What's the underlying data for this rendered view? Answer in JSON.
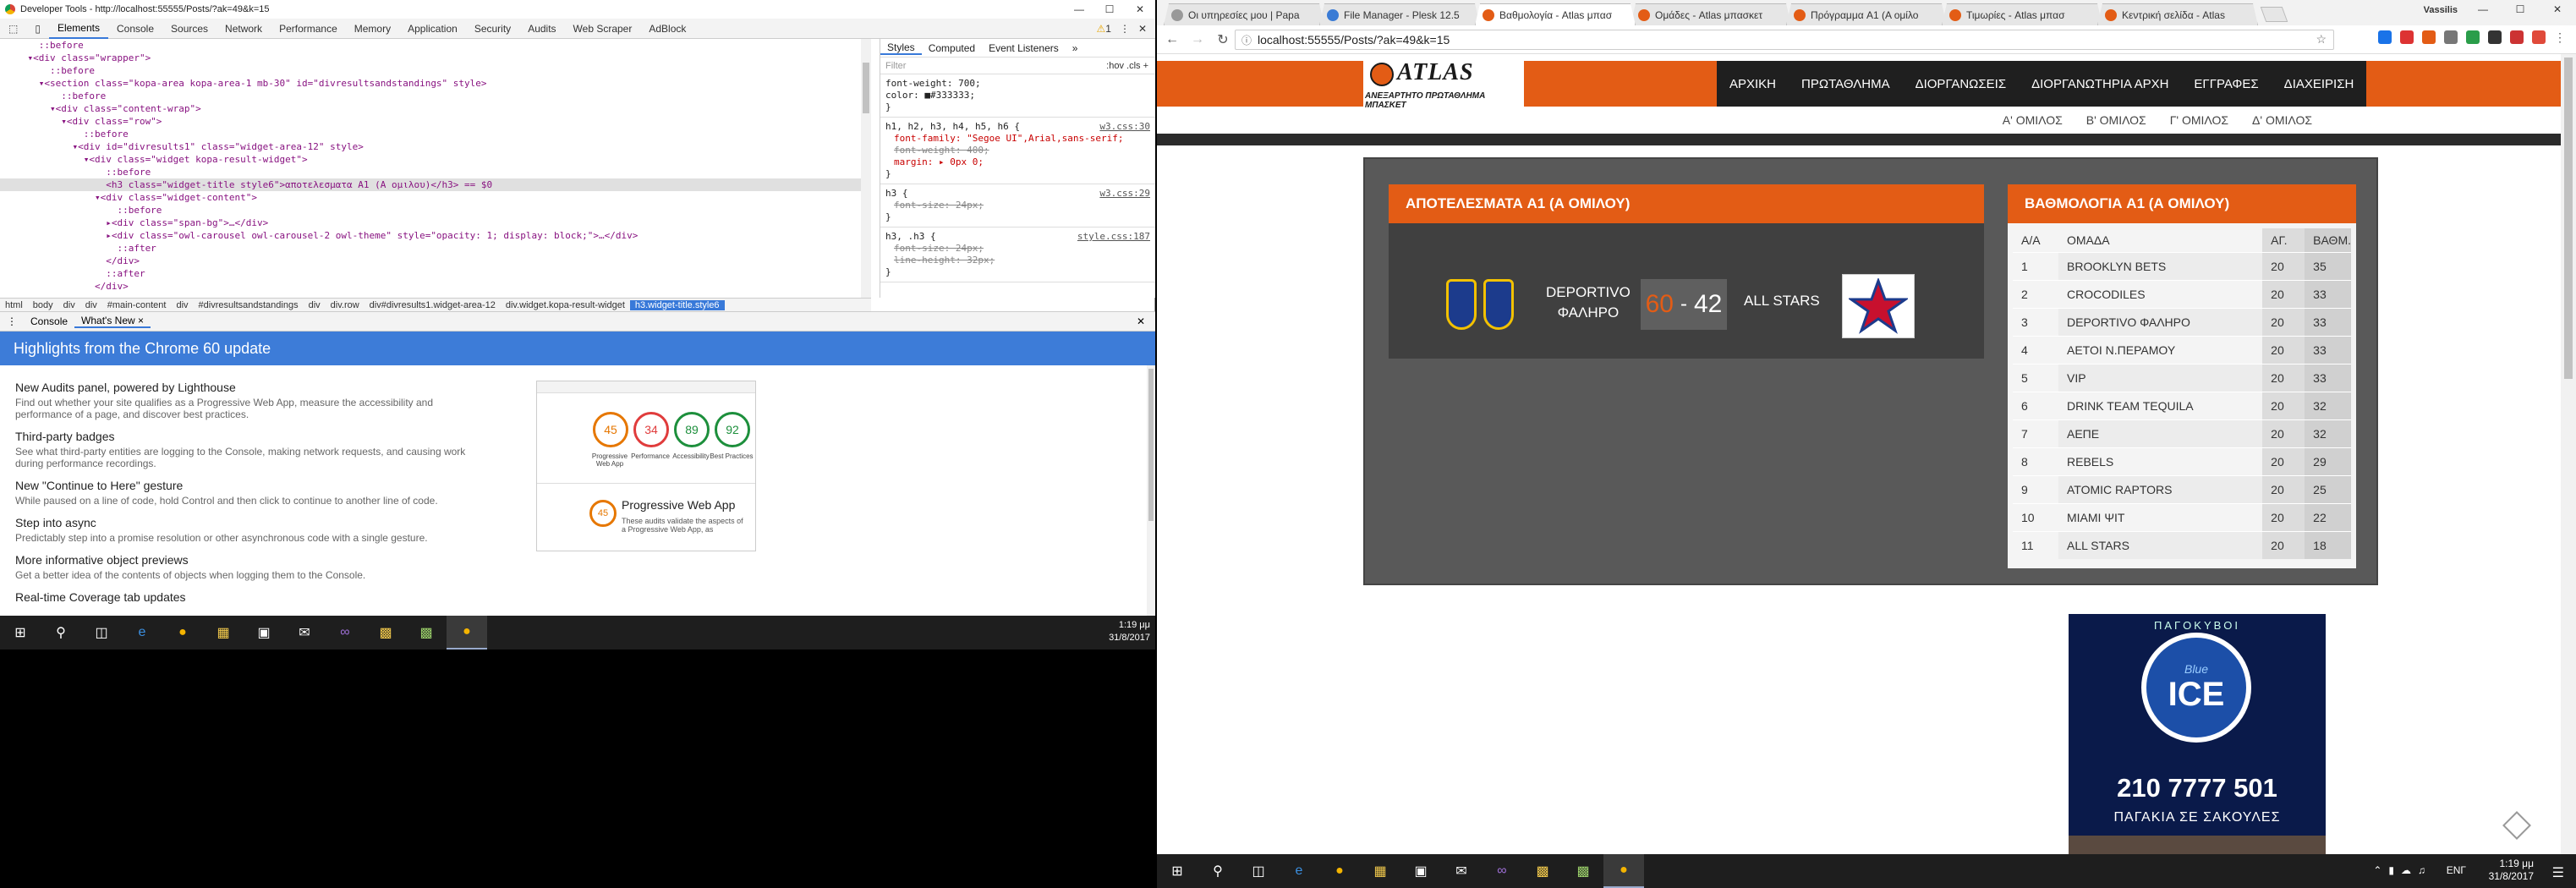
{
  "devtools": {
    "title": "Developer Tools - http://localhost:55555/Posts/?ak=49&k=15",
    "tabs": [
      "Elements",
      "Console",
      "Sources",
      "Network",
      "Performance",
      "Memory",
      "Application",
      "Security",
      "Audits",
      "Web Scraper",
      "AdBlock"
    ],
    "warning_count": "1",
    "dom_lines": [
      "      ::before",
      "    ▾<div class=\"wrapper\">",
      "        ::before",
      "      ▾<section class=\"kopa-area kopa-area-1 mb-30\" id=\"divresultsandstandings\" style>",
      "          ::before",
      "        ▾<div class=\"content-wrap\">",
      "          ▾<div class=\"row\">",
      "              ::before",
      "            ▾<div id=\"divresults1\" class=\"widget-area-12\" style>",
      "              ▾<div class=\"widget kopa-result-widget\">",
      "                  ::before",
      "                  <h3 class=\"widget-title style6\">αποτελεσματα A1 (Α ομιλου)</h3> == $0",
      "                ▾<div class=\"widget-content\">",
      "                    ::before",
      "                  ▸<div class=\"span-bg\">…</div>",
      "                  ▸<div class=\"owl-carousel owl-carousel-2 owl-theme\" style=\"opacity: 1; display: block;\">…</div>",
      "                    ::after",
      "                  </div>",
      "                  ::after",
      "                </div>"
    ],
    "styles_tabs": [
      "Styles",
      "Computed",
      "Event Listeners"
    ],
    "filter_placeholder": "Filter",
    "filter_tools": ":hov  .cls  +",
    "rules": [
      {
        "selector": "font-weight: 700;\ncolor: ■#333333;\n}",
        "source": ""
      },
      {
        "selector": "h1, h2, h3, h4, h5, h6 {",
        "source": "w3.css:30",
        "props": [
          "font-family: \"Segoe UI\",Arial,sans-serif;",
          "font-weight: 400;",
          "margin: ▸ 0px 0;",
          "}"
        ]
      },
      {
        "selector": "h3 {",
        "source": "w3.css:29",
        "props": [
          "font-size: 24px;",
          "}"
        ]
      },
      {
        "selector": "h3, .h3 {",
        "source": "style.css:187",
        "props": [
          "font-size: 24px;",
          "line-height: 32px;",
          "}"
        ]
      }
    ],
    "breadcrumbs": [
      "html",
      "body",
      "div",
      "div",
      "#main-content",
      "div",
      "#divresultsandstandings",
      "div",
      "div.row",
      "div#divresults1.widget-area-12",
      "div.widget.kopa-result-widget",
      "h3.widget-title.style6"
    ],
    "drawer_tabs": [
      "Console",
      "What's New ×"
    ],
    "whatsnew_title": "Highlights from the Chrome 60 update",
    "whatsnew_items": [
      {
        "h": "New Audits panel, powered by Lighthouse",
        "d": "Find out whether your site qualifies as a Progressive Web App, measure the accessibility and performance of a page, and discover best practices."
      },
      {
        "h": "Third-party badges",
        "d": "See what third-party entities are logging to the Console, making network requests, and causing work during performance recordings."
      },
      {
        "h": "New \"Continue to Here\" gesture",
        "d": "While paused on a line of code, hold Control and then click to continue to another line of code."
      },
      {
        "h": "Step into async",
        "d": "Predictably step into a promise resolution or other asynchronous code with a single gesture."
      },
      {
        "h": "More informative object previews",
        "d": "Get a better idea of the contents of objects when logging them to the Console."
      },
      {
        "h": "Real-time Coverage tab updates",
        "d": ""
      }
    ],
    "lighthouse": {
      "scores": [
        "45",
        "34",
        "89",
        "92"
      ],
      "labels": [
        "Progressive Web App",
        "Performance",
        "Accessibility",
        "Best Practices"
      ],
      "pwa_title": "Progressive Web App",
      "pwa_desc": "These audits validate the aspects of a Progressive Web App, as"
    }
  },
  "taskbar_left": {
    "time": "1:19 μμ",
    "date": "31/8/2017"
  },
  "chrome": {
    "tabs": [
      "Οι υπηρεσίες μου | Papa",
      "File Manager - Plesk 12.5",
      "Βαθμολογία - Atlas μπασ",
      "Ομάδες - Atlas μπασκετ",
      "Πρόγραμμα A1 (Α ομίλο",
      "Τιμωρίες - Atlas μπασ",
      "Κεντρική σελίδα - Atlas"
    ],
    "active_tab": 2,
    "user": "Vassilis",
    "url": "localhost:55555/Posts/?ak=49&k=15"
  },
  "site": {
    "logo_name": "ATLAS",
    "logo_sub": "ΑΝΕΞΑΡΤΗΤΟ ΠΡΩΤΑΘΛΗΜΑ ΜΠΑΣΚΕΤ",
    "nav": [
      "ΑΡΧΙΚΗ",
      "ΠΡΩΤΑΘΛΗΜΑ",
      "ΔΙΟΡΓΑΝΩΣΕΙΣ",
      "ΔΙΟΡΓΑΝΩΤΗΡΙΑ ΑΡΧΗ",
      "ΕΓΓΡΑΦΕΣ",
      "ΔΙΑΧΕΙΡΙΣΗ"
    ],
    "subnav": [
      "Α' ΟΜΙΛΟΣ",
      "Β' ΟΜΙΛΟΣ",
      "Γ' ΟΜΙΛΟΣ",
      "Δ' ΟΜΙΛΟΣ"
    ],
    "results_title": "ΑΠΟΤΕΛΕΣΜΑΤΑ A1 (Α ΟΜΙΛΟΥ)",
    "home_team_line1": "DEPORTIVO",
    "home_team_line2": "ΦΑΛΗΡΟ",
    "home_score": "60",
    "score_sep": "-",
    "away_score": "42",
    "away_team": "ALL STARS",
    "standings_title": "ΒΑΘΜΟΛΟΓΙΑ A1 (Α ΟΜΙΛΟΥ)",
    "standings_headers": [
      "Α/Α",
      "ΟΜΑΔΑ",
      "ΑΓ.",
      "ΒΑΘΜ."
    ],
    "standings": [
      [
        "1",
        "BROOKLYN BETS",
        "20",
        "35"
      ],
      [
        "2",
        "CROCODILES",
        "20",
        "33"
      ],
      [
        "3",
        "DEPORTIVO ΦΑΛΗΡΟ",
        "20",
        "33"
      ],
      [
        "4",
        "ΑΕΤΟΙ Ν.ΠΕΡΑΜΟΥ",
        "20",
        "33"
      ],
      [
        "5",
        "VIP",
        "20",
        "33"
      ],
      [
        "6",
        "DRINK TEAM TEQUILA",
        "20",
        "32"
      ],
      [
        "7",
        "ΑΕΠΕ",
        "20",
        "32"
      ],
      [
        "8",
        "REBELS",
        "20",
        "29"
      ],
      [
        "9",
        "ATOMIC RAPTORS",
        "20",
        "25"
      ],
      [
        "10",
        "MIAMI ΨΙΤ",
        "20",
        "22"
      ],
      [
        "11",
        "ALL STARS",
        "20",
        "18"
      ]
    ],
    "ad": {
      "top": "ΠΑΓΟΚΥΒΟΙ",
      "brand": "ICE",
      "brand_small": "Blue",
      "phone": "210 7777 501",
      "sub": "ΠΑΓΑΚΙΑ ΣΕ ΣΑΚΟΥΛΕΣ"
    }
  },
  "taskbar_right": {
    "time": "1:19 μμ",
    "date": "31/8/2017",
    "lang": "ΕΝΓ"
  }
}
